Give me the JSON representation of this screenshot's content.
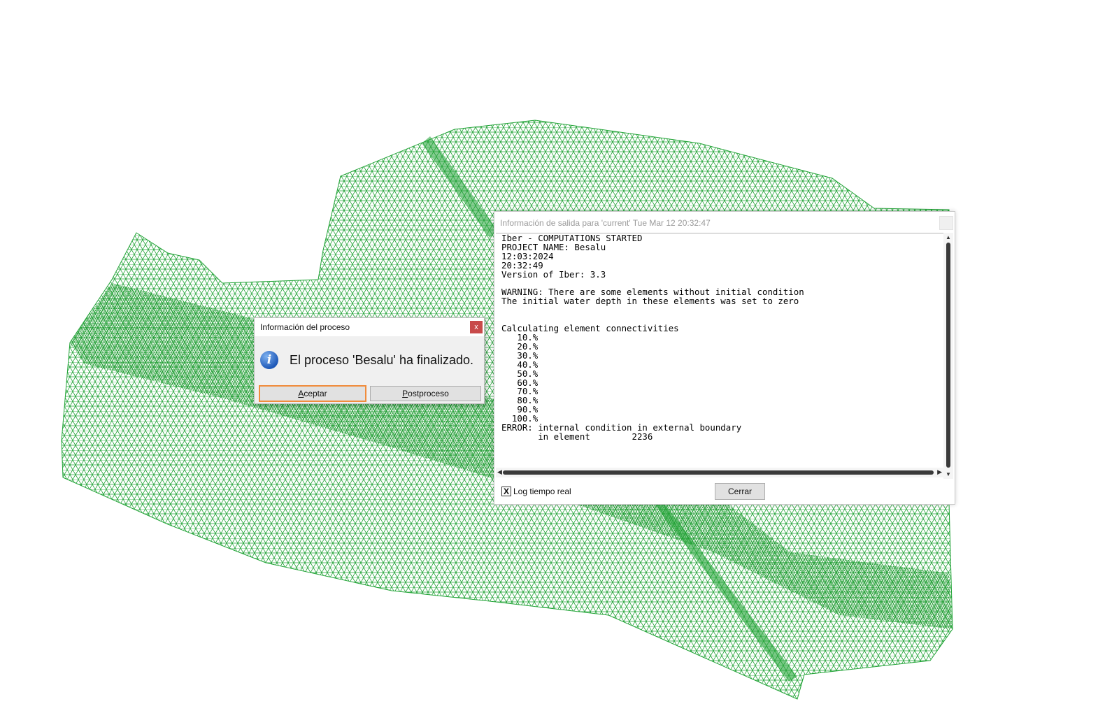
{
  "mesh": {
    "color": "#21a336",
    "dense_color": "#1e9a30"
  },
  "output_window": {
    "title": "Información de salida para 'current' Tue Mar 12 20:32:47",
    "log": "Iber - COMPUTATIONS STARTED\nPROJECT NAME: Besalu\n12:03:2024\n20:32:49\nVersion of Iber: 3.3\n\nWARNING: There are some elements without initial condition\nThe initial water depth in these elements was set to zero\n\n\nCalculating element connectivities\n   10.%\n   20.%\n   30.%\n   40.%\n   50.%\n   60.%\n   70.%\n   80.%\n   90.%\n  100.%\nERROR: internal condition in external boundary\n       in element        2236",
    "log_realtime_checkbox": {
      "label": "Log tiempo real",
      "checked": true,
      "mark": "X"
    },
    "close_button": "Cerrar"
  },
  "process_dialog": {
    "title": "Información del proceso",
    "close_glyph": "x",
    "icon": "info-icon",
    "icon_glyph": "i",
    "message": "El proceso 'Besalu' ha finalizado.",
    "accept_button": {
      "key": "A",
      "rest": "ceptar"
    },
    "postprocess_button": {
      "key": "P",
      "rest": "ostproceso"
    }
  }
}
